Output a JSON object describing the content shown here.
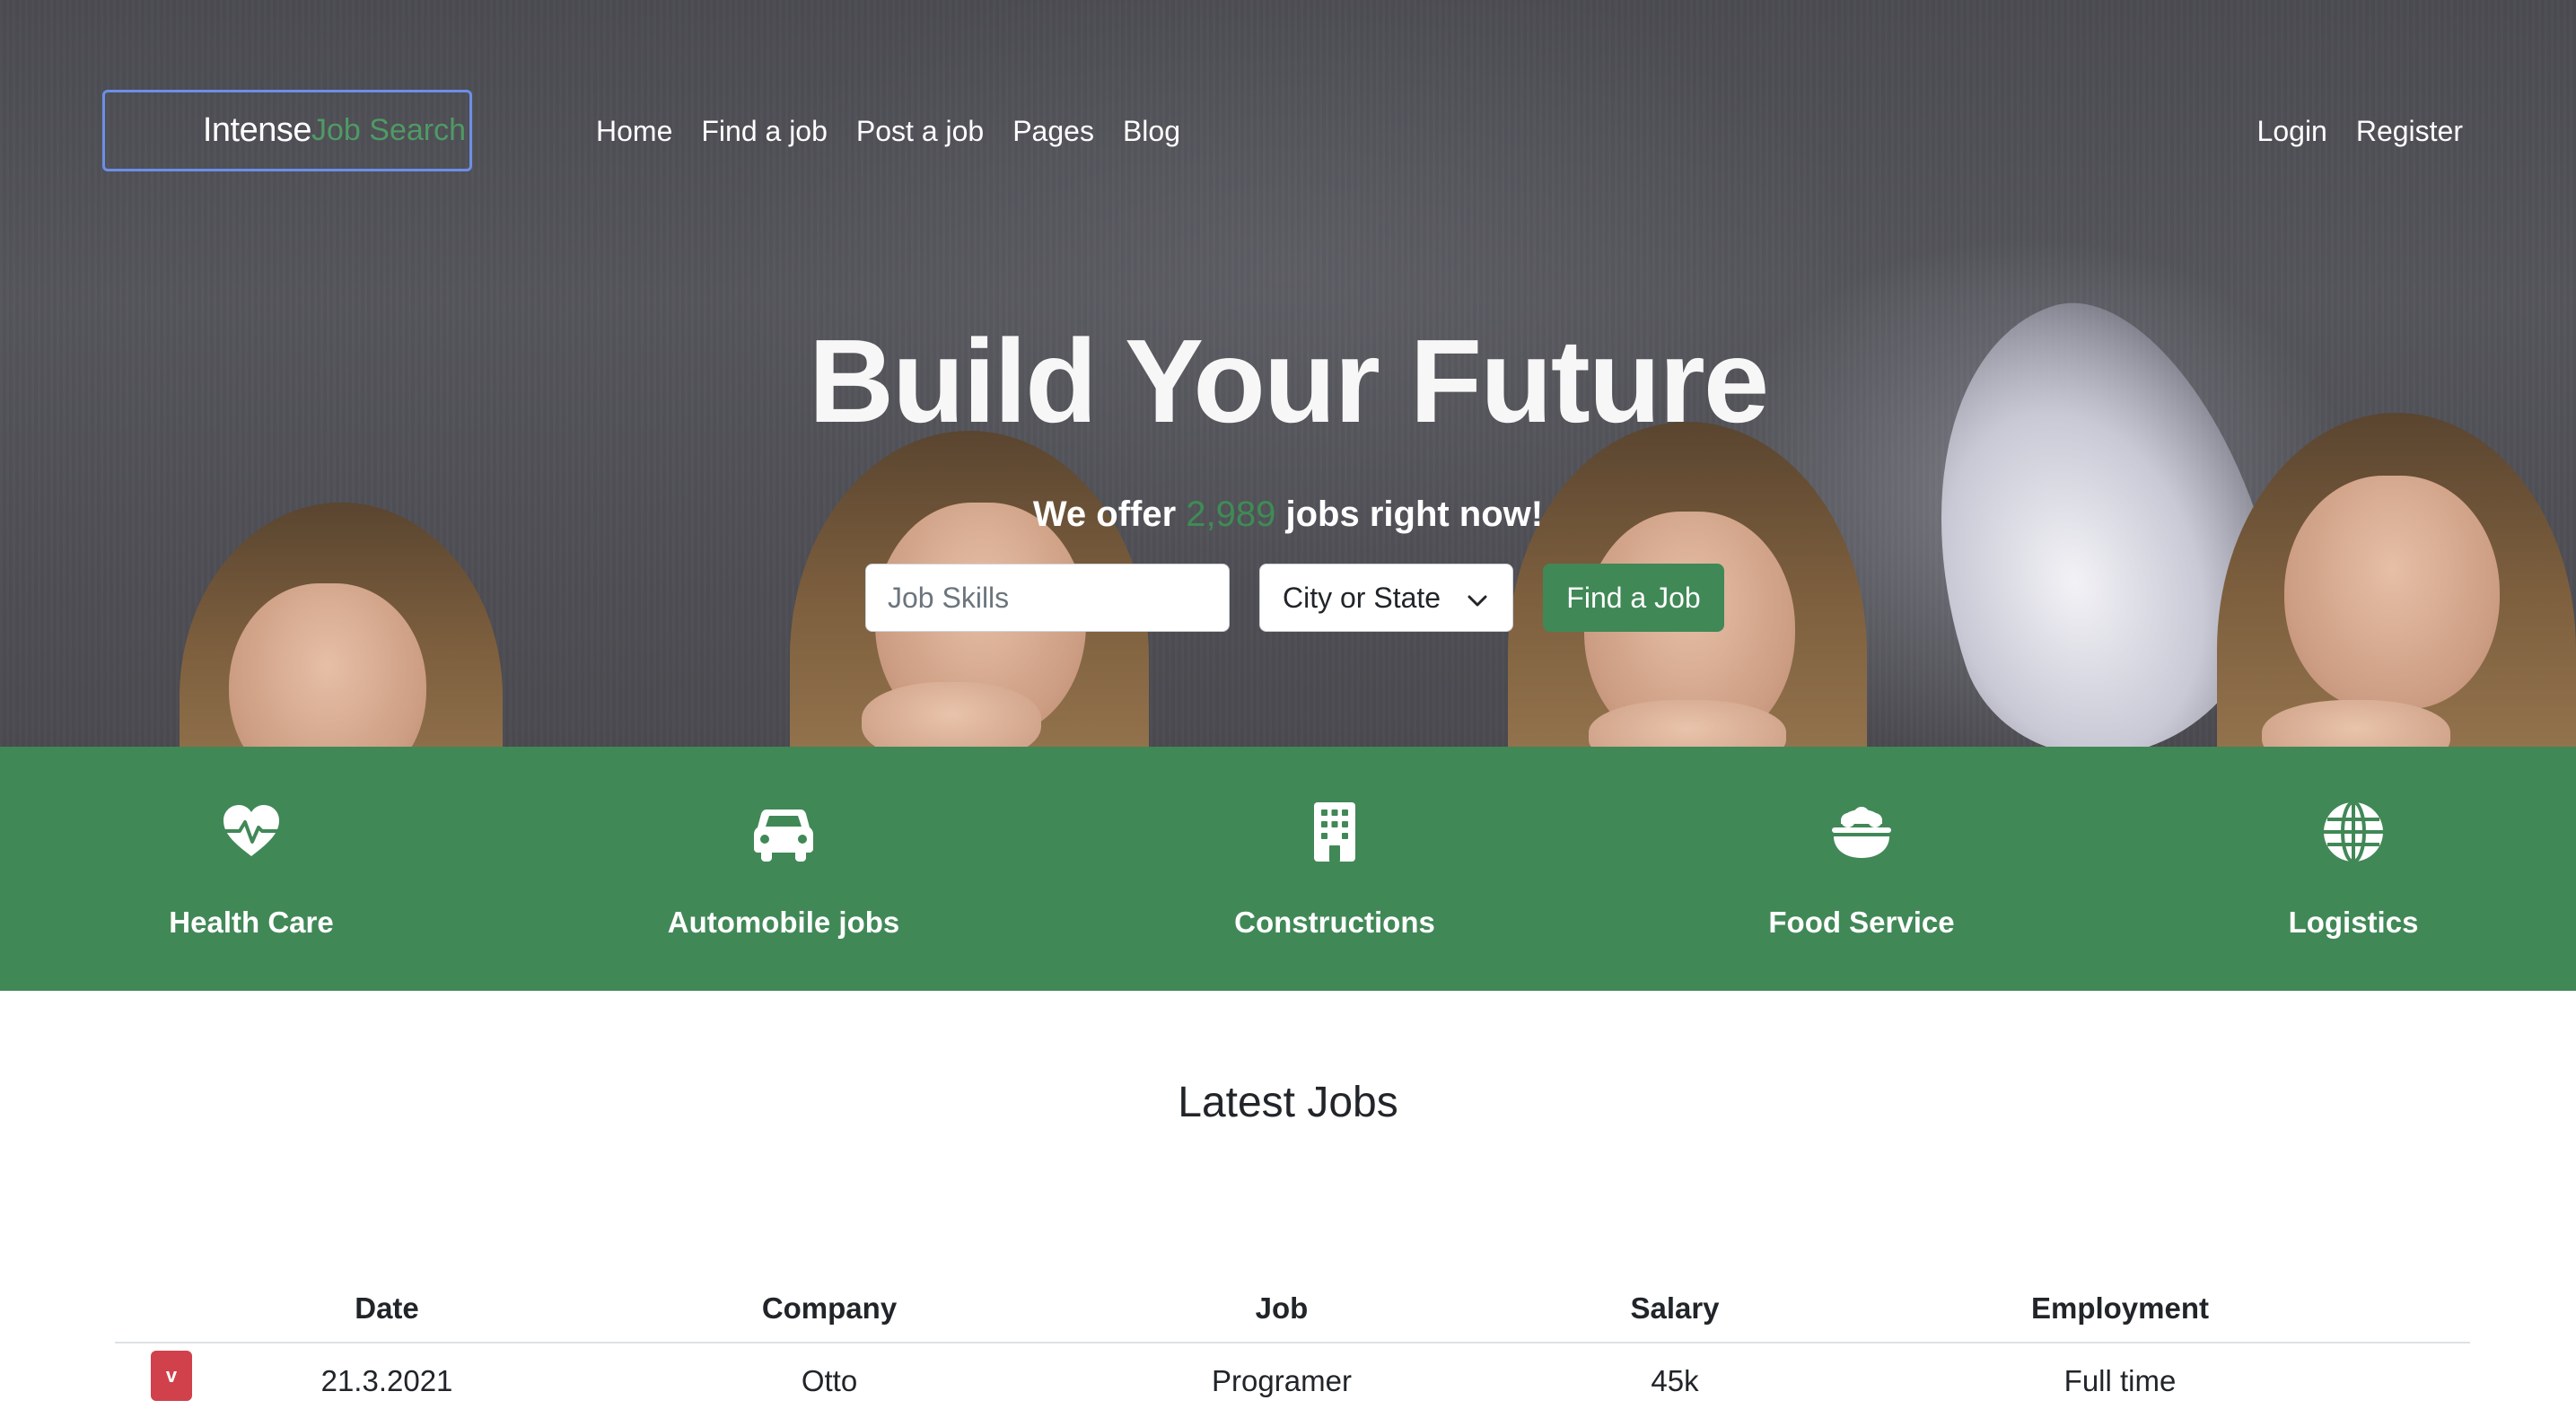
{
  "brand": {
    "part1": "Intense",
    "part2": "Job Search"
  },
  "nav": {
    "left": [
      "Home",
      "Find a job",
      "Post a job",
      "Pages",
      "Blog"
    ],
    "right": [
      "Login",
      "Register"
    ]
  },
  "hero": {
    "title": "Build Your Future",
    "subtitle_before": "We offer ",
    "job_count": "2,989",
    "subtitle_after": " jobs right now!",
    "search": {
      "skills_placeholder": "Job Skills",
      "location_selected": "City or State",
      "button_label": "Find a Job"
    }
  },
  "categories": [
    {
      "label": "Health Care",
      "icon": "heart-pulse-icon"
    },
    {
      "label": "Automobile jobs",
      "icon": "car-icon"
    },
    {
      "label": "Constructions",
      "icon": "building-icon"
    },
    {
      "label": "Food Service",
      "icon": "food-bowl-icon"
    },
    {
      "label": "Logistics",
      "icon": "globe-icon"
    }
  ],
  "latest": {
    "title": "Latest Jobs",
    "columns": [
      "Date",
      "Company",
      "Job",
      "Salary",
      "Employment"
    ],
    "rows": [
      {
        "badge": "v",
        "date": "21.3.2021",
        "company": "Otto",
        "job": "Programer",
        "salary": "45k",
        "employment": "Full time"
      }
    ]
  },
  "colors": {
    "accent_green": "#418857",
    "badge_red": "#d0414b",
    "focus_blue": "#6c8fe6"
  }
}
